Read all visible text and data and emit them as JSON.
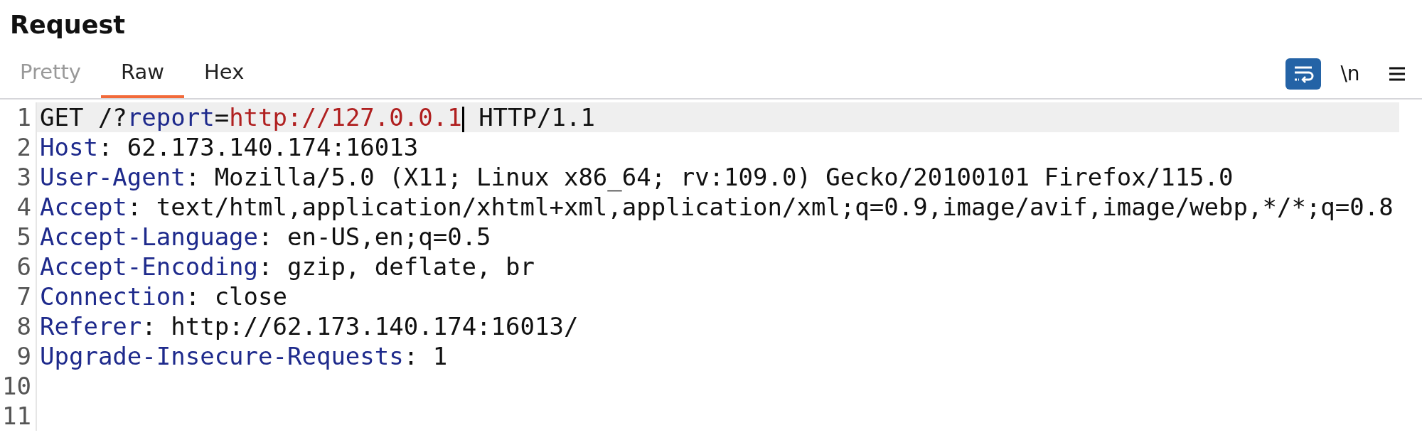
{
  "title": "Request",
  "tabs": [
    {
      "label": "Pretty",
      "selected": false,
      "disabled": true
    },
    {
      "label": "Raw",
      "selected": true,
      "disabled": false
    },
    {
      "label": "Hex",
      "selected": false,
      "disabled": false
    }
  ],
  "toolbar": {
    "wrap_lines": {
      "on": true
    },
    "newline_label": "\\n"
  },
  "lines": [
    {
      "number": "1",
      "current": true,
      "segments": [
        {
          "kind": "plain",
          "text": "GET /?"
        },
        {
          "kind": "key",
          "text": "report"
        },
        {
          "kind": "plain",
          "text": "="
        },
        {
          "kind": "param",
          "text": "http://127.0.0.1"
        },
        {
          "kind": "caret"
        },
        {
          "kind": "plain",
          "text": " HTTP/1.1"
        }
      ]
    },
    {
      "number": "2",
      "current": false,
      "segments": [
        {
          "kind": "key",
          "text": "Host"
        },
        {
          "kind": "plain",
          "text": ": 62.173.140.174:16013"
        }
      ]
    },
    {
      "number": "3",
      "current": false,
      "segments": [
        {
          "kind": "key",
          "text": "User-Agent"
        },
        {
          "kind": "plain",
          "text": ": Mozilla/5.0 (X11; Linux x86_64; rv:109.0) Gecko/20100101 Firefox/115.0"
        }
      ]
    },
    {
      "number": "4",
      "current": false,
      "segments": [
        {
          "kind": "key",
          "text": "Accept"
        },
        {
          "kind": "plain",
          "text": ": text/html,application/xhtml+xml,application/xml;q=0.9,image/avif,image/webp,*/*;q=0.8"
        }
      ]
    },
    {
      "number": "5",
      "current": false,
      "segments": [
        {
          "kind": "key",
          "text": "Accept-Language"
        },
        {
          "kind": "plain",
          "text": ": en-US,en;q=0.5"
        }
      ]
    },
    {
      "number": "6",
      "current": false,
      "segments": [
        {
          "kind": "key",
          "text": "Accept-Encoding"
        },
        {
          "kind": "plain",
          "text": ": gzip, deflate, br"
        }
      ]
    },
    {
      "number": "7",
      "current": false,
      "segments": [
        {
          "kind": "key",
          "text": "Connection"
        },
        {
          "kind": "plain",
          "text": ": close"
        }
      ]
    },
    {
      "number": "8",
      "current": false,
      "segments": [
        {
          "kind": "key",
          "text": "Referer"
        },
        {
          "kind": "plain",
          "text": ": http://62.173.140.174:16013/"
        }
      ]
    },
    {
      "number": "9",
      "current": false,
      "segments": [
        {
          "kind": "key",
          "text": "Upgrade-Insecure-Requests"
        },
        {
          "kind": "plain",
          "text": ": 1"
        }
      ]
    },
    {
      "number": "10",
      "current": false
    },
    {
      "number": "11",
      "current": false
    }
  ]
}
